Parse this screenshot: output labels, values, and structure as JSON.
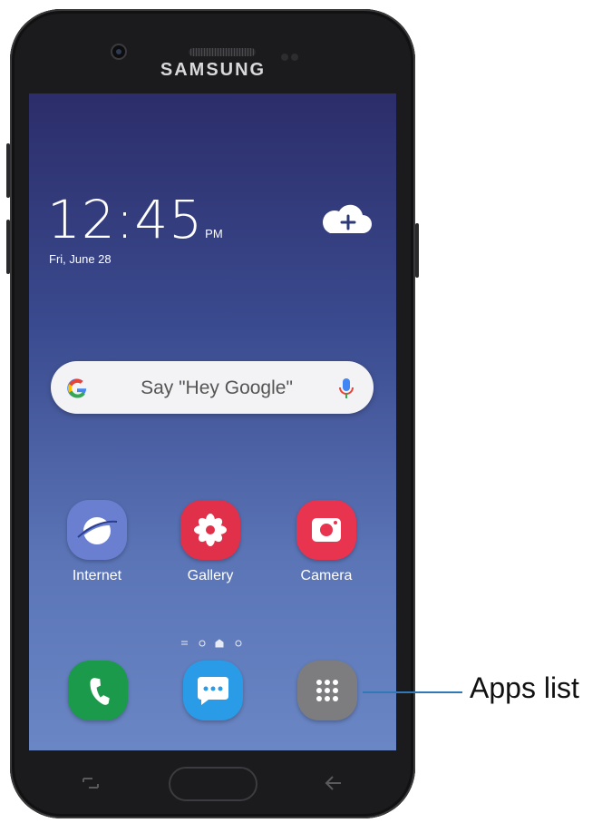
{
  "device": {
    "brand": "SAMSUNG"
  },
  "lock_clock": {
    "time": "12:45",
    "ampm": "PM",
    "date": "Fri, June 28"
  },
  "widgets": {
    "cloud_icon": "cloud-plus-icon"
  },
  "search_bar": {
    "placeholder": "Say \"Hey Google\"",
    "left_icon": "google-g-icon",
    "right_icon": "microphone-icon"
  },
  "apps": [
    {
      "label": "Internet",
      "icon": "internet-icon",
      "color": "#6a7fd0"
    },
    {
      "label": "Gallery",
      "icon": "gallery-icon",
      "color": "#e0304a"
    },
    {
      "label": "Camera",
      "icon": "camera-icon",
      "color": "#e8344f"
    }
  ],
  "page_indicator": {
    "pages": 4,
    "current": 2
  },
  "dock": [
    {
      "icon": "phone-icon",
      "color": "#1a9a4a"
    },
    {
      "icon": "messages-icon",
      "color": "#2a9be6"
    },
    {
      "icon": "apps-grid-icon",
      "color": "#7d7d80"
    }
  ],
  "callout": {
    "label": "Apps list",
    "color": "#3178b6"
  }
}
